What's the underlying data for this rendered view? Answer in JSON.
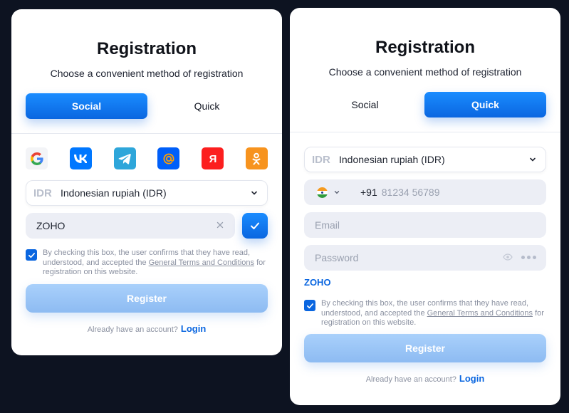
{
  "left": {
    "title": "Registration",
    "subtitle": "Choose a convenient method of registration",
    "tabs": [
      {
        "label": "Social",
        "active": true
      },
      {
        "label": "Quick",
        "active": false
      }
    ],
    "social_icons": [
      {
        "name": "google-icon",
        "color": "#ffffff"
      },
      {
        "name": "vk-icon",
        "color": "#0077ff"
      },
      {
        "name": "telegram-icon",
        "color": "#2ea6da"
      },
      {
        "name": "mailru-icon",
        "color": "#005ff9"
      },
      {
        "name": "yandex-icon",
        "color": "#fc1f1f"
      },
      {
        "name": "odnoklassniki-icon",
        "color": "#f7931e"
      }
    ],
    "currency": {
      "code": "IDR",
      "name": "Indonesian rupiah (IDR)"
    },
    "promo": {
      "value": "ZOHO"
    },
    "terms": {
      "before": "By checking this box, the user confirms that they have read, understood, and accepted the ",
      "link": "General Terms and Conditions",
      "after": " for registration on this website."
    },
    "register_label": "Register",
    "login": {
      "prompt": "Already have an account?",
      "link": "Login"
    }
  },
  "right": {
    "title": "Registration",
    "subtitle": "Choose a convenient method of registration",
    "tabs": [
      {
        "label": "Social",
        "active": false
      },
      {
        "label": "Quick",
        "active": true
      }
    ],
    "currency": {
      "code": "IDR",
      "name": "Indonesian rupiah (IDR)"
    },
    "phone": {
      "country_code": "+91",
      "placeholder": "81234 56789"
    },
    "email": {
      "placeholder": "Email"
    },
    "password": {
      "placeholder": "Password"
    },
    "promo_link": "ZOHO",
    "terms": {
      "before": "By checking this box, the user confirms that they have read, understood, and accepted the ",
      "link": "General Terms and Conditions",
      "after": " for registration on this website."
    },
    "register_label": "Register",
    "login": {
      "prompt": "Already have an account?",
      "link": "Login"
    }
  },
  "colors": {
    "accent": "#0a66e0",
    "register_disabled": "#9cc6f7",
    "background": "#0d1321"
  }
}
